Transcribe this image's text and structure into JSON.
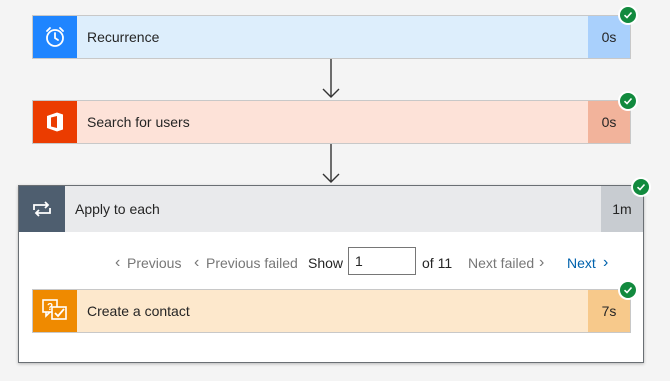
{
  "flow": {
    "recurrence": {
      "label": "Recurrence",
      "duration": "0s",
      "icon": "alarm-clock-icon",
      "accent": "#1f85ff"
    },
    "search_users": {
      "label": "Search for users",
      "duration": "0s",
      "icon": "office-icon",
      "accent": "#eb3c00"
    },
    "apply_to_each": {
      "label": "Apply to each",
      "duration": "1m",
      "icon": "loop-icon",
      "accent": "#4e5e6f"
    },
    "create_contact": {
      "label": "Create a contact",
      "duration": "7s",
      "icon": "chat-question-icon",
      "accent": "#ef8a00"
    }
  },
  "pager": {
    "previous": "Previous",
    "previous_failed": "Previous failed",
    "show": "Show",
    "current": "1",
    "of_total": "of 11",
    "next_failed": "Next failed",
    "next": "Next"
  },
  "status": {
    "success_color": "#128a3e"
  }
}
